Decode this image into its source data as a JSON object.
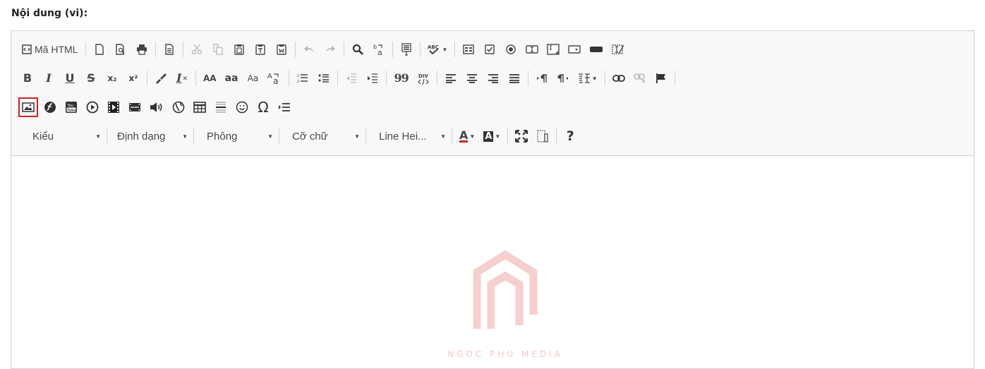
{
  "field": {
    "label": "Nội dung (vi):"
  },
  "toolbar": {
    "source_label": "Mã HTML",
    "combos": {
      "styles": "Kiểu",
      "format": "Định dạng",
      "font": "Phông",
      "size": "Cỡ chữ",
      "line_height": "Line Hei..."
    },
    "glyphs": {
      "bold": "B",
      "italic": "I",
      "underline": "U",
      "strike": "S",
      "subscript": "x₂",
      "superscript": "x²",
      "remove_format": "I",
      "uppercase": "AA",
      "lowercase": "aa",
      "capitalize": "Aa",
      "blockquote": "99",
      "special_char": "Ω",
      "text_color": "A",
      "bg_color": "A",
      "help": "?"
    },
    "selected_button": "image"
  },
  "watermark": {
    "text": "NGOC PHU MEDIA"
  },
  "colors": {
    "accent_red": "#d42121",
    "toolbar_bg": "#f8f8f8",
    "border": "#d1d1d1"
  }
}
